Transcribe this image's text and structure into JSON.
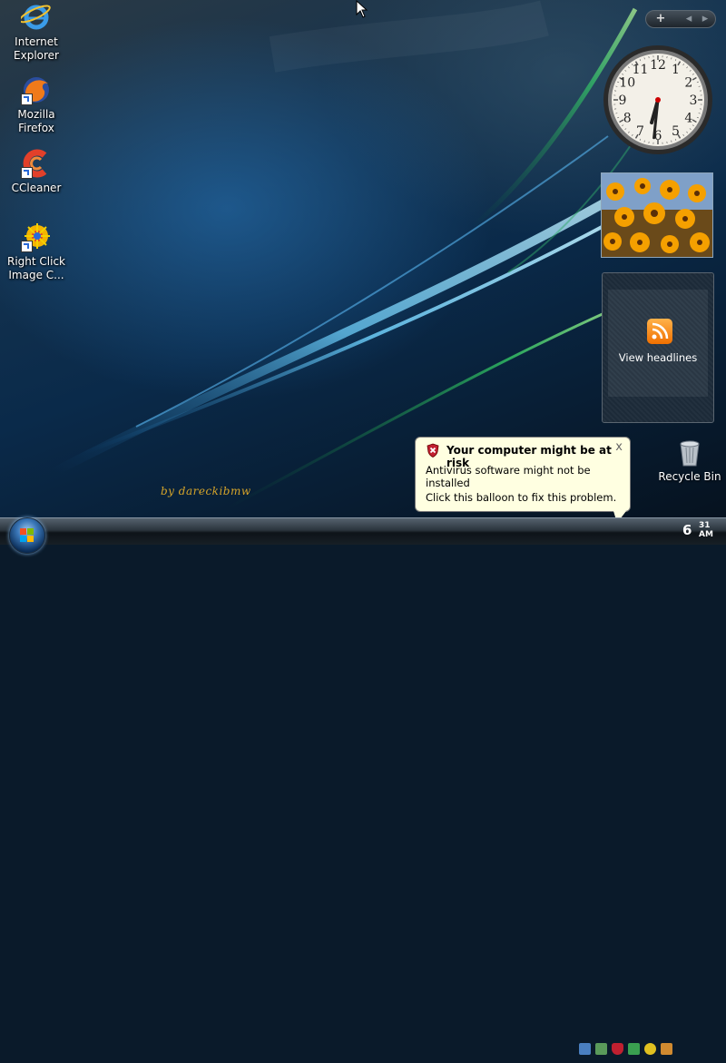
{
  "desktop_icons": [
    {
      "label_line1": "Internet",
      "label_line2": "Explorer",
      "icon": "internet-explorer-icon"
    },
    {
      "label_line1": "Mozilla Firefox",
      "label_line2": "",
      "icon": "firefox-icon"
    },
    {
      "label_line1": "CCleaner",
      "label_line2": "",
      "icon": "ccleaner-icon"
    },
    {
      "label_line1": "Right Click",
      "label_line2": "Image C...",
      "icon": "right-click-image-converter-icon"
    }
  ],
  "gadget_controls": {
    "add": "+",
    "prev": "◂",
    "next": "▸"
  },
  "clock_gadget": {
    "hour_numbers": [
      "12",
      "1",
      "2",
      "3",
      "4",
      "5",
      "6",
      "7",
      "8",
      "9",
      "10",
      "11"
    ],
    "time_hour": 6,
    "time_minute": 31
  },
  "feed_gadget": {
    "label": "View headlines",
    "icon": "rss-icon"
  },
  "recycle_bin": {
    "label": "Recycle Bin",
    "icon": "recycle-bin-icon"
  },
  "watermark": "by dareckibmw",
  "balloon": {
    "title": "Your computer might be at risk",
    "line1": "Antivirus software might not be installed",
    "line2": "Click this balloon to fix this problem.",
    "close": "x",
    "icon": "security-shield-icon"
  },
  "taskbar": {
    "start_icon": "windows-start-icon",
    "clock_hour": "6",
    "clock_minutes": "31",
    "clock_ampm": "AM",
    "tray_icons": [
      "network-icon",
      "display-icon",
      "security-alert-icon",
      "update-icon",
      "app-s-icon",
      "wand-icon"
    ]
  },
  "colors": {
    "balloon_bg": "#ffffe1",
    "watermark": "#d6a52a",
    "rss": "#f07000"
  }
}
